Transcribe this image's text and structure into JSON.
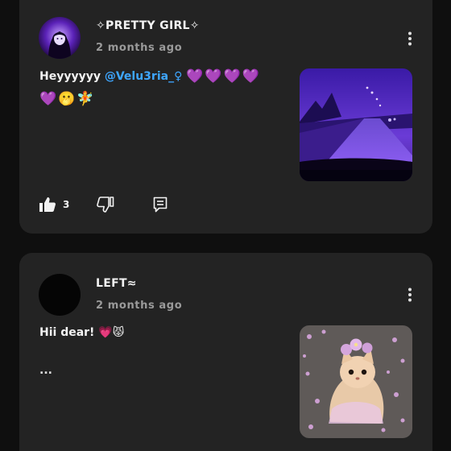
{
  "posts": [
    {
      "author": "✧PRETTY GIRL✧",
      "time": "2 months ago",
      "text_prefix": "Heyyyyyy ",
      "mention": "@Velu3ria_♀",
      "emoji_line1": "💜💜💜💜",
      "emoji_line2": "💜🫢🧚",
      "likes": "3",
      "thumbnail": "night-road-purple-photo"
    },
    {
      "author": "LEFT≈",
      "time": "2 months ago",
      "text": "Hii dear! 💗😾",
      "more": "...",
      "thumbnail": "kitten-with-flowers-photo"
    }
  ],
  "colors": {
    "background": "#0f0f0f",
    "card": "#232323",
    "mention": "#3ea6ff",
    "timestamp": "#9a9a9a"
  },
  "icons": [
    "more-vert-icon",
    "thumb-up-icon",
    "thumb-down-icon",
    "reply-icon"
  ]
}
